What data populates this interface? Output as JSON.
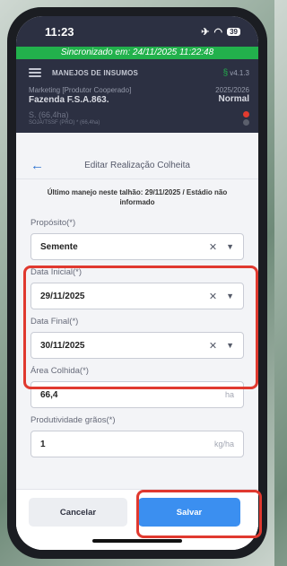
{
  "statusbar": {
    "time": "11:23",
    "battery": "39"
  },
  "sync": {
    "text": "Sincronizado em: 24/11/2025 11:22:48"
  },
  "appheader": {
    "title": "MANEJOS DE INSUMOS",
    "version": "v4.1.3",
    "farm_type": "Marketing [Produtor Cooperado]",
    "farm_name": "Fazenda F.S.A.863.",
    "season": "2025/2026",
    "season_type": "Normal",
    "area": "S. (66,4ha)",
    "area_sub": "SOJA/TSSF (PRO) * (66,4ha)"
  },
  "page": {
    "title": "Editar Realização Colheita",
    "last_info": "Último manejo neste talhão: 29/11/2025 / Estádio não informado"
  },
  "fields": {
    "proposito": {
      "label": "Propósito(*)",
      "value": "Semente"
    },
    "data_inicial": {
      "label": "Data Inicial(*)",
      "value": "29/11/2025"
    },
    "data_final": {
      "label": "Data Final(*)",
      "value": "30/11/2025"
    },
    "area_colhida": {
      "label": "Área Colhida(*)",
      "value": "66,4",
      "unit": "ha"
    },
    "produtividade": {
      "label": "Produtividade grãos(*)",
      "value": "1",
      "unit": "kg/ha"
    }
  },
  "buttons": {
    "cancel": "Cancelar",
    "save": "Salvar"
  },
  "colors": {
    "accent": "#3b8ff0",
    "sync": "#22b14c",
    "highlight": "#e0392f",
    "header": "#2c3042"
  },
  "icons": [
    "menu-icon",
    "signal-icon",
    "wifi-icon",
    "airplane-icon",
    "back-arrow-icon",
    "clear-icon",
    "chevron-down-icon"
  ]
}
